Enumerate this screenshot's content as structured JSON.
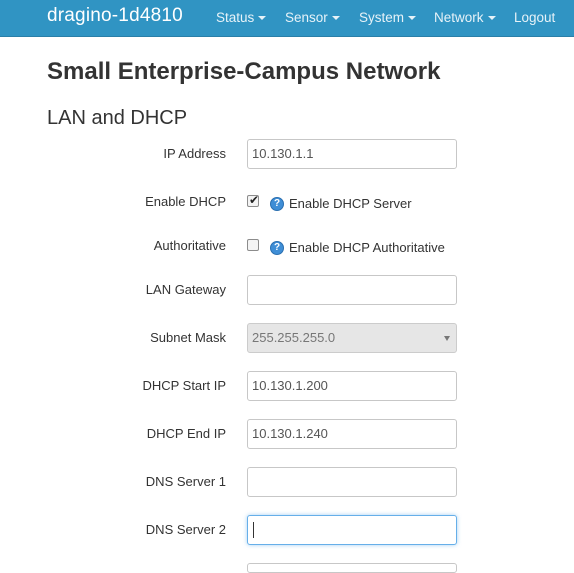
{
  "navbar": {
    "brand": "dragino-1d4810",
    "menu": [
      {
        "label": "Status",
        "has_dropdown": true
      },
      {
        "label": "Sensor",
        "has_dropdown": true
      },
      {
        "label": "System",
        "has_dropdown": true
      },
      {
        "label": "Network",
        "has_dropdown": true
      },
      {
        "label": "Logout",
        "has_dropdown": false
      }
    ],
    "color": "#3094c3"
  },
  "page": {
    "title": "Small Enterprise-Campus Network",
    "section_title": "LAN and DHCP"
  },
  "form": {
    "ip_address": {
      "label": "IP Address",
      "value": "10.130.1.1"
    },
    "enable_dhcp": {
      "label": "Enable DHCP",
      "checked": true,
      "help_icon": "question-icon",
      "help_text": "Enable DHCP Server"
    },
    "authoritative": {
      "label": "Authoritative",
      "checked": false,
      "help_icon": "question-icon",
      "help_text": "Enable DHCP Authoritative"
    },
    "lan_gateway": {
      "label": "LAN Gateway",
      "value": ""
    },
    "subnet_mask": {
      "label": "Subnet Mask",
      "value": "255.255.255.0",
      "disabled": true
    },
    "dhcp_start_ip": {
      "label": "DHCP Start IP",
      "value": "10.130.1.200"
    },
    "dhcp_end_ip": {
      "label": "DHCP End IP",
      "value": "10.130.1.240"
    },
    "dns_server_1": {
      "label": "DNS Server 1",
      "value": ""
    },
    "dns_server_2": {
      "label": "DNS Server 2",
      "value": "",
      "focused": true
    }
  }
}
